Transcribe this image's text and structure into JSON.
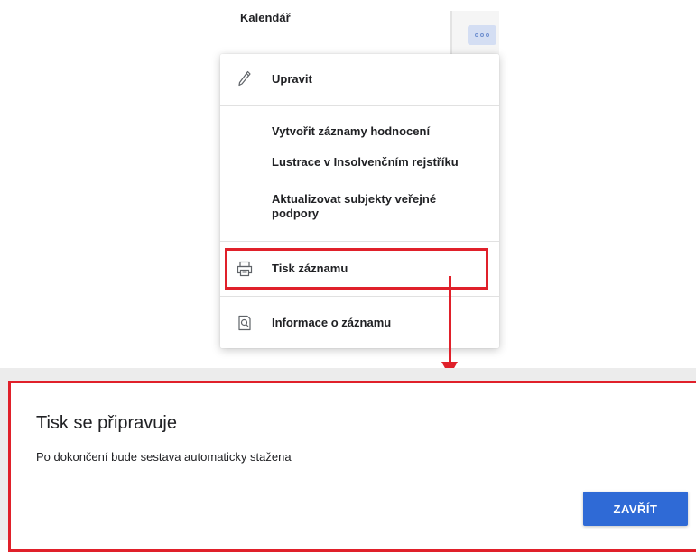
{
  "background": {
    "title": "Kalendář"
  },
  "menu": {
    "items": [
      {
        "label": "Upravit",
        "icon": "pencil-icon"
      },
      {
        "label": "Vytvořit záznamy hodnocení"
      },
      {
        "label": "Lustrace v Insolvenčním rejstříku"
      },
      {
        "label": "Aktualizovat subjekty veřejné podpory"
      },
      {
        "label": "Tisk záznamu",
        "icon": "print-icon"
      },
      {
        "label": "Informace o záznamu",
        "icon": "record-info-icon"
      }
    ]
  },
  "dialog": {
    "title": "Tisk se připravuje",
    "message": "Po dokončení bude sestava automaticky stažena",
    "close_label": "ZAVŘÍT"
  },
  "colors": {
    "highlight": "#e0202a",
    "primary_button": "#2f6ad6",
    "more_button": "#d4def3"
  }
}
